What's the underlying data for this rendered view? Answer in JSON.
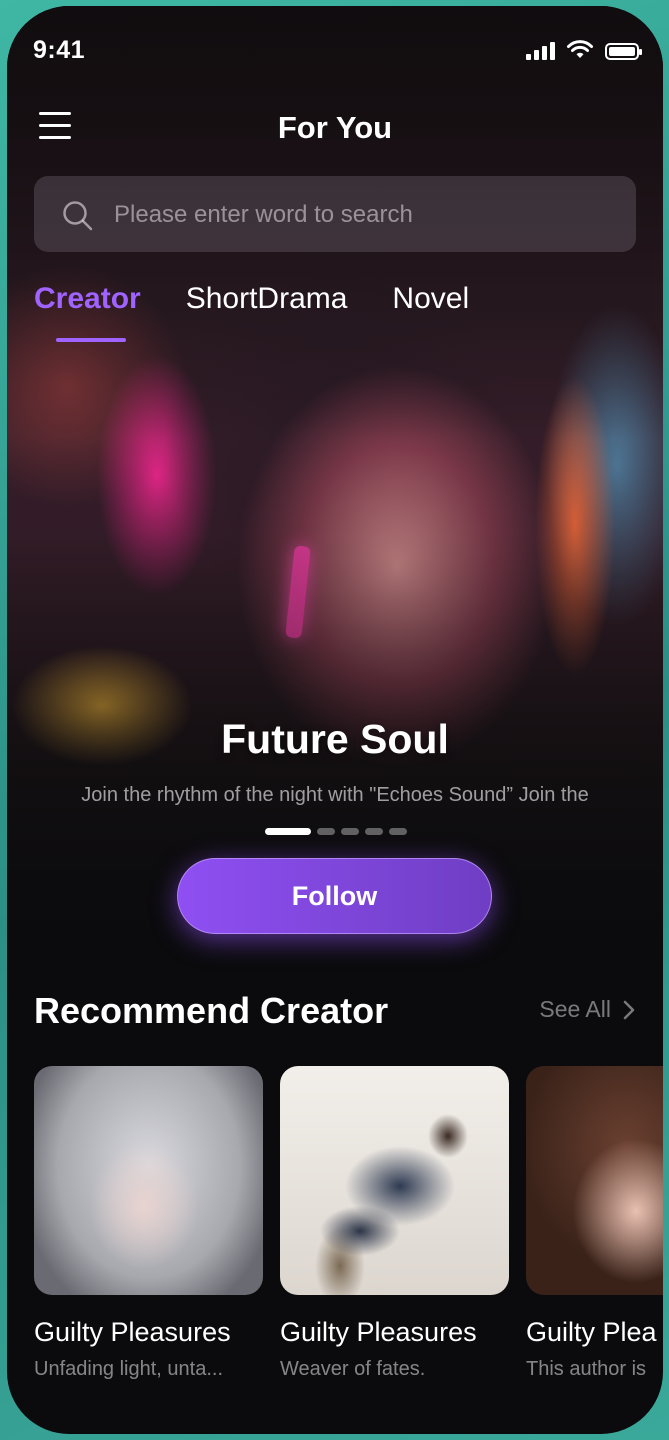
{
  "status_bar": {
    "time": "9:41"
  },
  "header": {
    "title": "For You"
  },
  "search": {
    "placeholder": "Please enter word to search"
  },
  "tabs": [
    {
      "label": "Creator",
      "active": true
    },
    {
      "label": "ShortDrama",
      "active": false
    },
    {
      "label": "Novel",
      "active": false
    }
  ],
  "hero": {
    "title": "Future Soul",
    "description": "Join the rhythm of the night with \"Echoes Sound” Join the",
    "slides_total": 5,
    "slide_active": 1,
    "follow_label": "Follow"
  },
  "recommend": {
    "title": "Recommend Creator",
    "see_all_label": "See All",
    "creators": [
      {
        "name": "Guilty Pleasures",
        "description": "Unfading light, unta..."
      },
      {
        "name": "Guilty Pleasures",
        "description": "Weaver of fates."
      },
      {
        "name": "Guilty Plea",
        "description": "This author is"
      }
    ]
  },
  "colors": {
    "accent": "#a063ff",
    "button_gradient_start": "#8f4ff2",
    "button_gradient_end": "#6f3ec4",
    "background": "#0b0b0d",
    "frame": "#3fb7a4"
  },
  "icons": {
    "menu": "menu-icon",
    "search": "search-icon",
    "see_all": "chevron-right-icon"
  }
}
